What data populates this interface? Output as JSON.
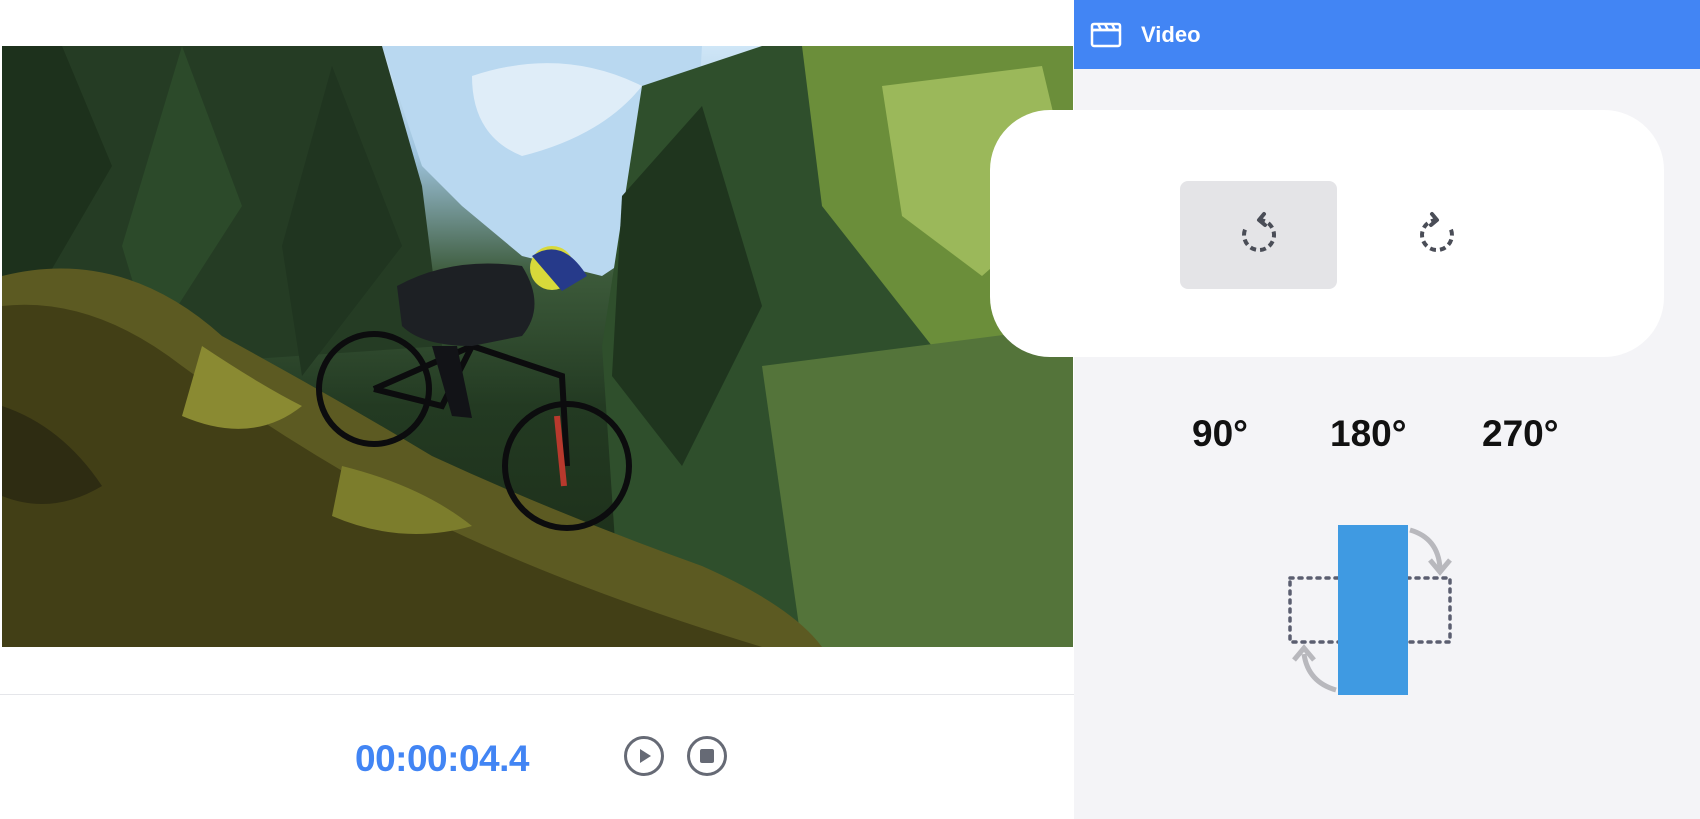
{
  "panel": {
    "title": "Video",
    "icon": "clapperboard-icon",
    "accent_color": "#4285f4"
  },
  "rotate": {
    "left_icon": "rotate-counterclockwise-icon",
    "right_icon": "rotate-clockwise-icon",
    "active": "counterclockwise",
    "angles": [
      "90°",
      "180°",
      "270°"
    ]
  },
  "player": {
    "timecode": "00:00:04.4",
    "play_icon": "play-icon",
    "stop_icon": "stop-icon"
  },
  "preview": {
    "illustration": "rotation-diagram"
  }
}
